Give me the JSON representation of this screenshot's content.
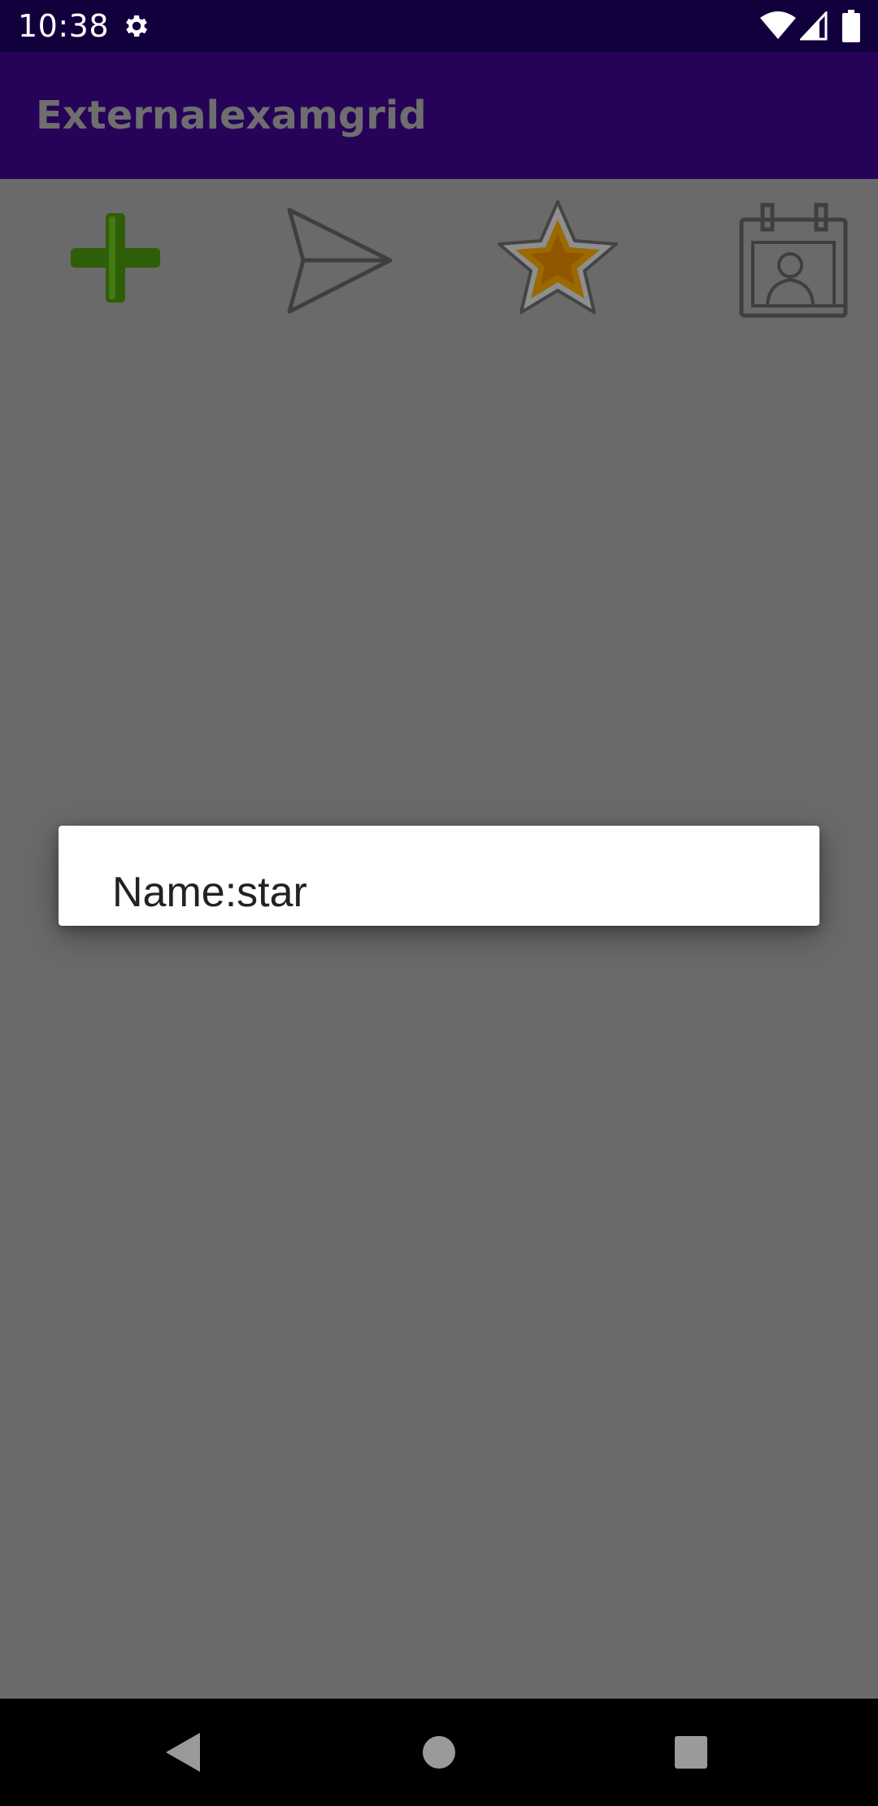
{
  "status_bar": {
    "time": "10:38",
    "icons": [
      "gear-icon",
      "wifi-icon",
      "signal-icon",
      "battery-icon"
    ]
  },
  "app_bar": {
    "title": "Externalexamgrid"
  },
  "grid": {
    "items": [
      {
        "icon": "add-icon",
        "color": "#2f5e08"
      },
      {
        "icon": "send-icon",
        "color": "#3f3f3f"
      },
      {
        "icon": "star-icon",
        "color": "#9a6a00"
      },
      {
        "icon": "calendar-icon",
        "color": "#3f3f3f"
      }
    ]
  },
  "dialog": {
    "message": "Name:star"
  },
  "nav_bar": {
    "icons": [
      "back-icon",
      "home-icon",
      "recents-icon"
    ]
  },
  "colors": {
    "status_bar": "#12003d",
    "app_bar_dimmed": "#260259",
    "scrim": "#6a6a6a",
    "dialog_bg": "#ffffff"
  }
}
